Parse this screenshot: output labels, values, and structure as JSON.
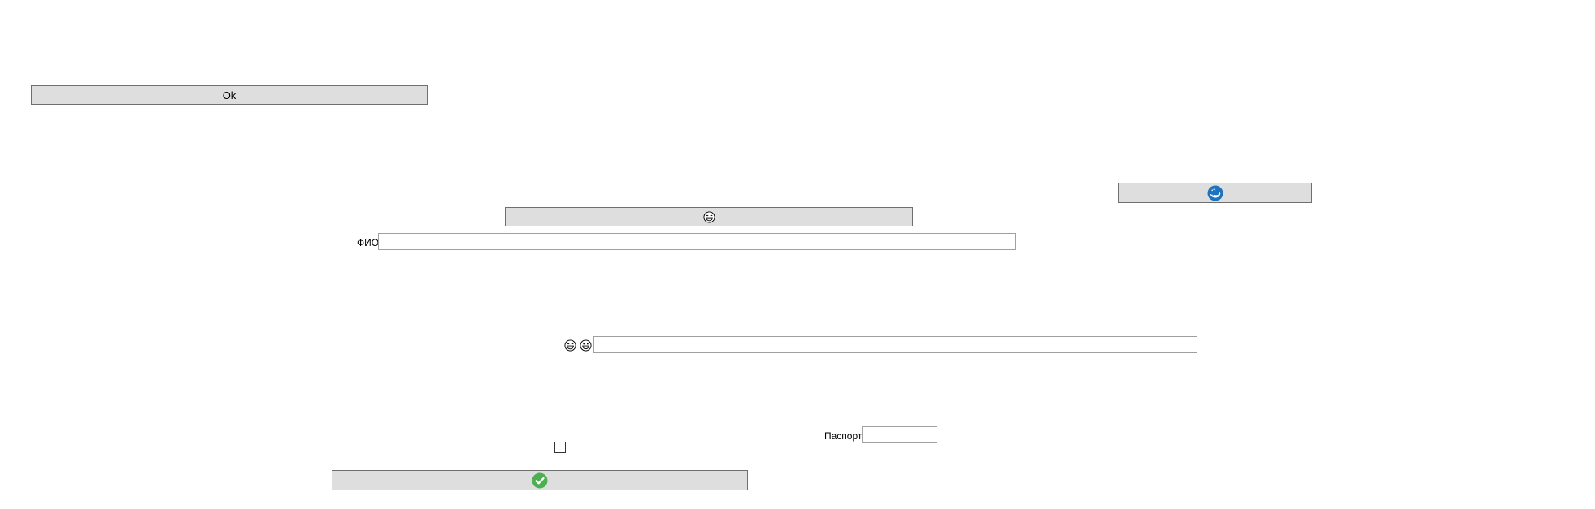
{
  "ok_button": {
    "label": "Ok"
  },
  "laugh_button": {
    "icon": "laughing-face-icon"
  },
  "whale_button": {
    "icon": "whale-icon",
    "accent": "#1e73be"
  },
  "fio": {
    "label": "ФИО",
    "value": "",
    "placeholder": ""
  },
  "emoji_field": {
    "icons": [
      "laughing-face-icon",
      "grinning-face-icon"
    ],
    "value": "",
    "placeholder": ""
  },
  "passport": {
    "label": "Паспорт",
    "value": "",
    "placeholder": ""
  },
  "agree_checkbox": {
    "checked": false
  },
  "confirm_button": {
    "icon": "checkmark-circle-icon",
    "accent": "#4caf50"
  }
}
